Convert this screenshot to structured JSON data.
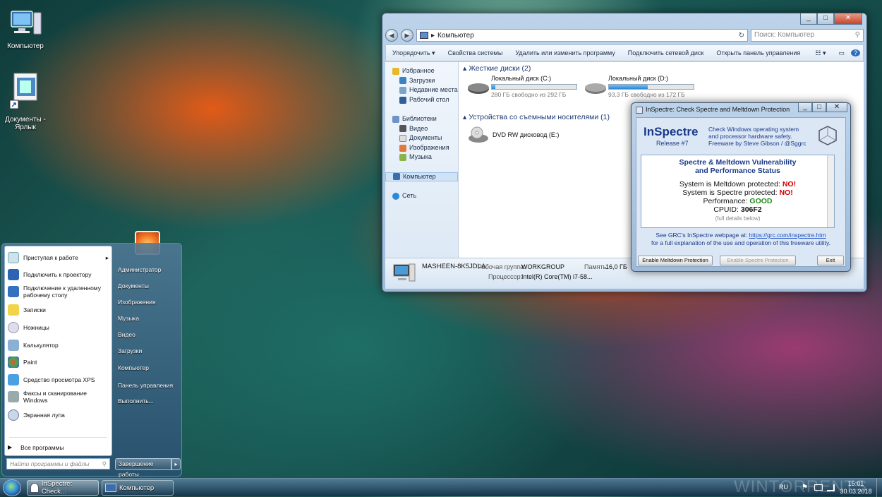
{
  "desktop": {
    "icons": [
      {
        "label": "Компьютер"
      },
      {
        "label": "Документы -\nЯрлык"
      }
    ]
  },
  "explorer": {
    "address": "Компьютер",
    "search_placeholder": "Поиск: Компьютер",
    "toolbar": [
      "Упорядочить ▾",
      "Свойства системы",
      "Удалить или изменить программу",
      "Подключить сетевой диск",
      "Открыть панель управления"
    ],
    "nav": [
      {
        "label": "Избранное",
        "level": 0
      },
      {
        "label": "Загрузки",
        "level": 1
      },
      {
        "label": "Недавние места",
        "level": 1
      },
      {
        "label": "Рабочий стол",
        "level": 1
      },
      {
        "label": "",
        "level": 0
      },
      {
        "label": "Библиотеки",
        "level": 0
      },
      {
        "label": "Видео",
        "level": 1
      },
      {
        "label": "Документы",
        "level": 1
      },
      {
        "label": "Изображения",
        "level": 1
      },
      {
        "label": "Музыка",
        "level": 1
      },
      {
        "label": "",
        "level": 0
      },
      {
        "label": "Компьютер",
        "level": 0
      },
      {
        "label": "",
        "level": 0
      },
      {
        "label": "Сеть",
        "level": 0
      }
    ],
    "groups": {
      "hard_disks": "Жесткие диски (2)",
      "removable": "Устройства со съемными носителями (1)"
    },
    "drives": [
      {
        "name": "Локальный диск (C:)",
        "free": "280 ГБ свободно из 292 ГБ",
        "used_fraction": 0.04
      },
      {
        "name": "Локальный диск (D:)",
        "free": "93,3 ГБ свободно из 172 ГБ",
        "used_fraction": 0.46
      }
    ],
    "dvd": "DVD RW дисковод (E:)",
    "details": {
      "computer_name": "MASHEEN-8K5JDLA",
      "workgroup_label": "Рабочая группа:",
      "workgroup": "WORKGROUP",
      "memory_label": "Память:",
      "memory": "16,0 ГБ",
      "cpu_label": "Процессор:",
      "cpu": "Intel(R) Core(TM) i7-58..."
    }
  },
  "inspectre": {
    "title": "InSpectre: Check Spectre and Meltdown Protection",
    "app_name": "InSpectre",
    "release": "Release #7",
    "tagline": "Check Windows operating system\nand processor hardware safety.\nFreeware by Steve Gibson / @Sggrc",
    "heading": "Spectre & Meltdown Vulnerability\nand Performance Status",
    "rows": [
      {
        "label": "System is Meltdown protected: ",
        "value": "NO!",
        "color": "#d40000"
      },
      {
        "label": "System is Spectre protected: ",
        "value": "NO!",
        "color": "#d40000"
      },
      {
        "label": "Performance: ",
        "value": "GOOD",
        "color": "#1a8a1a"
      },
      {
        "label": "CPUID: ",
        "value": "306F2",
        "color": "#111111"
      }
    ],
    "footnote": "(full details below)",
    "see_text": "See GRC's InSpectre webpage at: ",
    "link": "https://grc.com/inspectre.htm",
    "see_text2": "for a full explanation of the use and operation of this freeware utility.",
    "buttons": {
      "meltdown": "Enable Meltdown Protection",
      "spectre": "Enable Spectre Protection",
      "exit": "Exit"
    }
  },
  "start_menu": {
    "programs": [
      {
        "label": "Приступая к работе",
        "arrow": "▸"
      },
      {
        "label": "Подключить к проектору"
      },
      {
        "label": "Подключение к удаленному\nрабочему столу"
      },
      {
        "label": "Записки"
      },
      {
        "label": "Ножницы"
      },
      {
        "label": "Калькулятор"
      },
      {
        "label": "Paint"
      },
      {
        "label": "Средство просмотра XPS"
      },
      {
        "label": "Факсы и сканирование\nWindows"
      },
      {
        "label": "Экранная лупа"
      }
    ],
    "all_programs": "Все программы",
    "search_placeholder": "Найти программы и файлы",
    "right_items": [
      "Администратор",
      "Документы",
      "Изображения",
      "Музыка",
      "Видео",
      "Загрузки",
      "Компьютер",
      "Панель управления",
      "Выполнить..."
    ],
    "shutdown": "Завершение работы"
  },
  "taskbar": {
    "buttons": [
      "InSpectre: Check...",
      "Компьютер"
    ],
    "lang": "RU",
    "time": "15:01",
    "date": "30.03.2018"
  },
  "watermark": "WINTORRENTS"
}
